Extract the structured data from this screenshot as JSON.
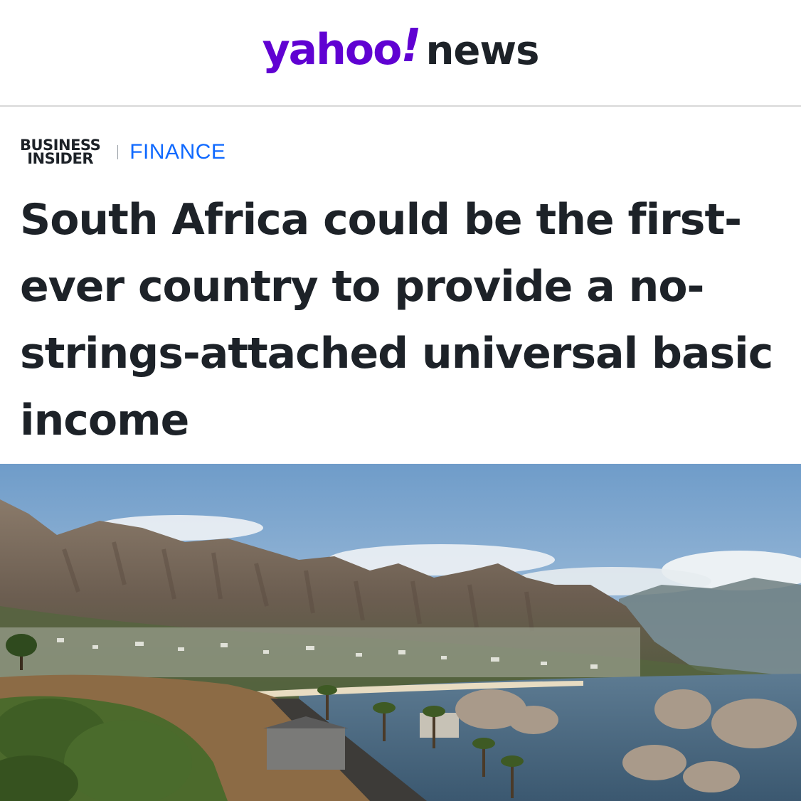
{
  "header": {
    "logo_yahoo": "yahoo",
    "logo_bang": "!",
    "logo_news": "news",
    "brand_color": "#6001d2"
  },
  "article": {
    "source_line1": "BUSINESS",
    "source_line2": "INSIDER",
    "category": "FINANCE",
    "category_color": "#0f69ff",
    "headline": "South Africa could be the first-ever country to provide a no-strings-attached universal basic income"
  },
  "hero_image": {
    "subject": "coastal-mountain-landscape"
  }
}
